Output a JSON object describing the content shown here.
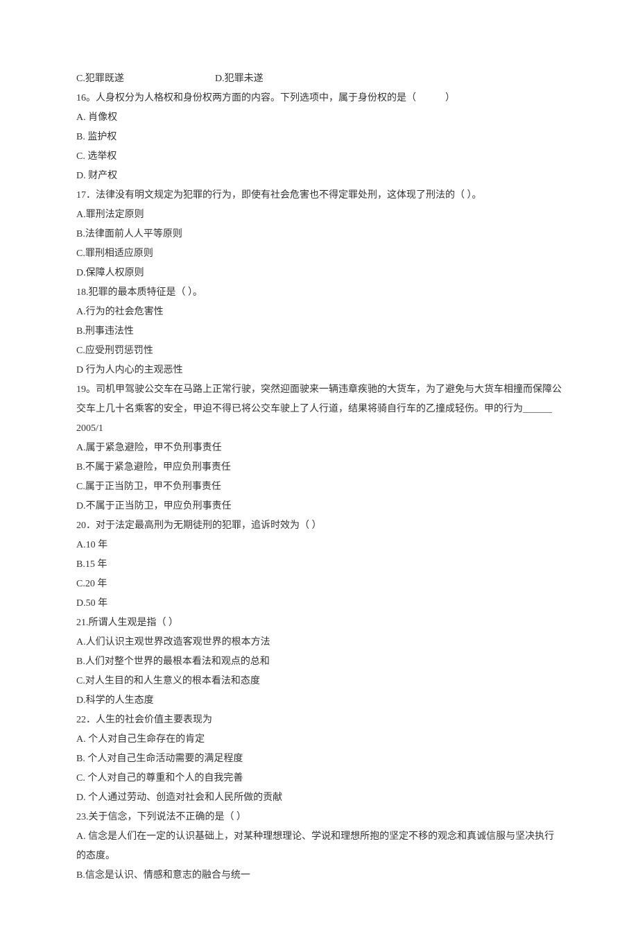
{
  "q15_opts": {
    "c": "C.犯罪既遂",
    "d": "D.犯罪未遂"
  },
  "q16": {
    "stem": "16。人身权分为人格权和身份权两方面的内容。下列选项中，属于身份权的是（　　　）",
    "a": "A. 肖像权",
    "b": "B. 监护权",
    "c": "C. 选举权",
    "d": "D. 财产权"
  },
  "q17": {
    "stem": "17．法律没有明文规定为犯罪的行为，即使有社会危害也不得定罪处刑，这体现了刑法的（ ）。",
    "a": "A.罪刑法定原则",
    "b": "B.法律面前人人平等原则",
    "c": "C.罪刑相适应原则",
    "d": "D.保障人权原则"
  },
  "q18": {
    "stem": "18.犯罪的最本质特征是（ ）。",
    "a": "A.行为的社会危害性",
    "b": "B.刑事违法性",
    "c": "C.应受刑罚惩罚性",
    "d": "D 行为人内心的主观恶性"
  },
  "q19": {
    "stem": "19。司机甲驾驶公交车在马路上正常行驶，突然迎面驶来一辆违章疾驰的大货车，为了避免与大货车相撞而保障公交车上几十名乘客的安全，甲迫不得已将公交车驶上了人行道，结果将骑自行车的乙撞成轻伤。甲的行为______ 2005/1",
    "a": "A.属于紧急避险，甲不负刑事责任",
    "b": "B.不属于紧急避险，甲应负刑事责任",
    "c": "C.属于正当防卫，甲不负刑事责任",
    "d": "D.不属于正当防卫，甲应负刑事责任"
  },
  "q20": {
    "stem": "20．对于法定最高刑为无期徒刑的犯罪，追诉时效为（ ）",
    "a": "A.10 年",
    "b": "B.15 年",
    "c": "C.20 年",
    "d": "D.50 年"
  },
  "q21": {
    "stem": "21.所谓人生观是指（ ）",
    "a": "A.人们认识主观世界改造客观世界的根本方法",
    "b": "B.人们对整个世界的最根本看法和观点的总和",
    "c": "C.对人生目的和人生意义的根本看法和态度",
    "d": "D.科学的人生态度"
  },
  "q22": {
    "stem": "22．人生的社会价值主要表现为",
    "a": "A. 个人对自己生命存在的肯定",
    "b": "B. 个人对自己生命活动需要的满足程度",
    "c": "C. 个人对自己的尊重和个人的自我完善",
    "d": "D. 个人通过劳动、创造对社会和人民所做的贡献"
  },
  "q23": {
    "stem": "23.关于信念，下列说法不正确的是（ ）",
    "a": "A. 信念是人们在一定的认识基础上，对某种理想理论、学说和理想所抱的坚定不移的观念和真诚信服与坚决执行的态度。",
    "b": "B.信念是认识、情感和意志的融合与统一"
  }
}
